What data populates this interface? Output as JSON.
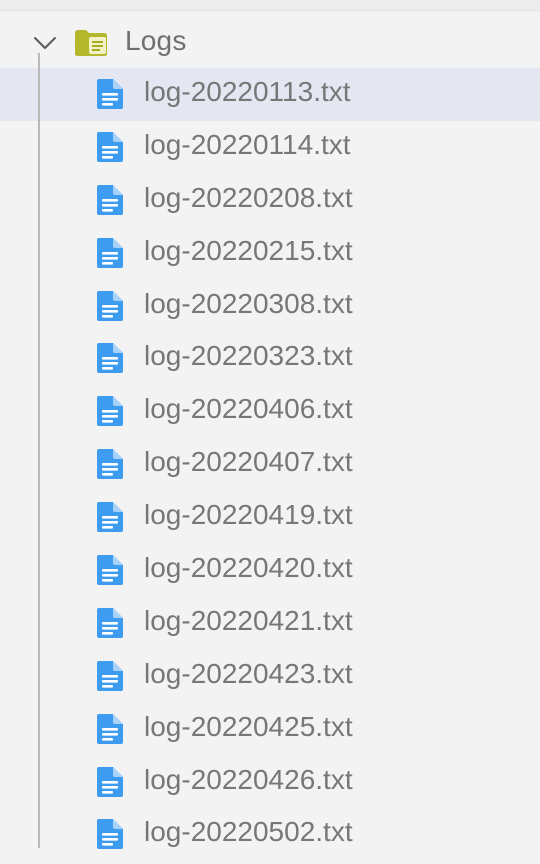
{
  "explorer": {
    "folder": {
      "name": "Logs",
      "expanded": true,
      "icon": "folder-icon"
    },
    "selected_index": 0,
    "files": [
      {
        "name": "log-20220113.txt",
        "icon": "file-text-icon"
      },
      {
        "name": "log-20220114.txt",
        "icon": "file-text-icon"
      },
      {
        "name": "log-20220208.txt",
        "icon": "file-text-icon"
      },
      {
        "name": "log-20220215.txt",
        "icon": "file-text-icon"
      },
      {
        "name": "log-20220308.txt",
        "icon": "file-text-icon"
      },
      {
        "name": "log-20220323.txt",
        "icon": "file-text-icon"
      },
      {
        "name": "log-20220406.txt",
        "icon": "file-text-icon"
      },
      {
        "name": "log-20220407.txt",
        "icon": "file-text-icon"
      },
      {
        "name": "log-20220419.txt",
        "icon": "file-text-icon"
      },
      {
        "name": "log-20220420.txt",
        "icon": "file-text-icon"
      },
      {
        "name": "log-20220421.txt",
        "icon": "file-text-icon"
      },
      {
        "name": "log-20220423.txt",
        "icon": "file-text-icon"
      },
      {
        "name": "log-20220425.txt",
        "icon": "file-text-icon"
      },
      {
        "name": "log-20220426.txt",
        "icon": "file-text-icon"
      },
      {
        "name": "log-20220502.txt",
        "icon": "file-text-icon"
      }
    ]
  },
  "colors": {
    "background": "#f3f3f3",
    "selection": "#e4e6f1",
    "file_icon": "#3d9bf0",
    "folder_icon": "#b5b82c",
    "label": "#777777"
  }
}
